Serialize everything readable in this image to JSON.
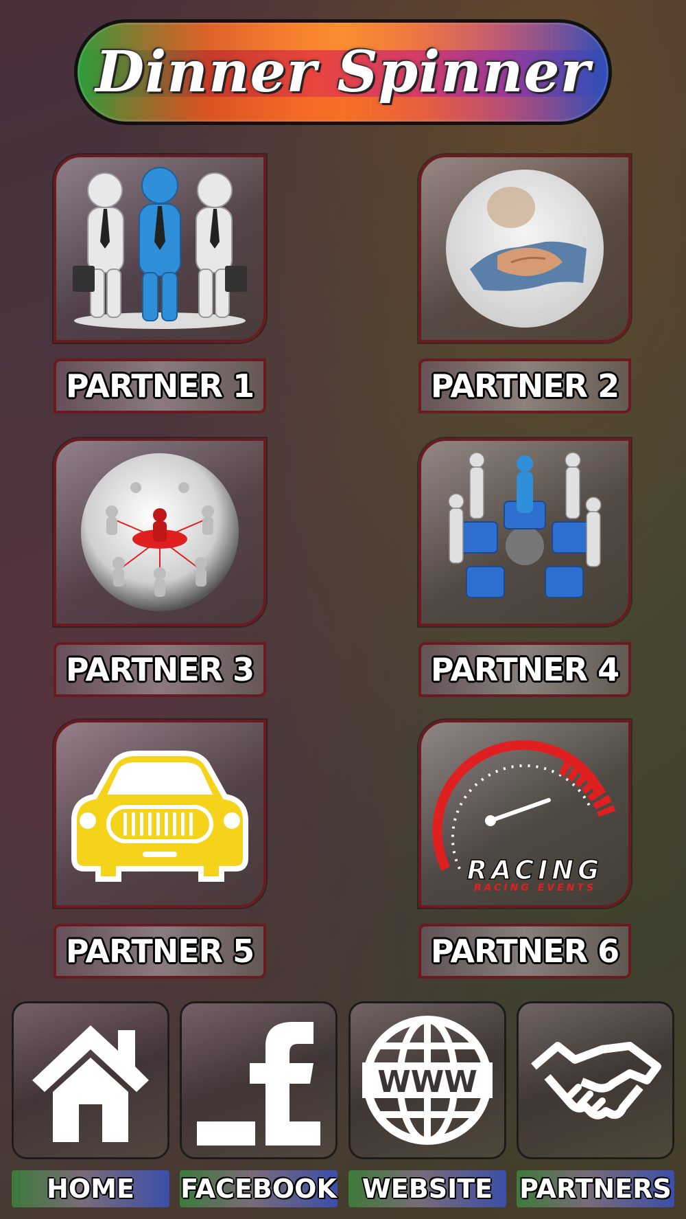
{
  "header": {
    "title": "Dinner Spinner"
  },
  "partners": [
    {
      "label": "PARTNER 1",
      "icon": "business-team-icon"
    },
    {
      "label": "PARTNER 2",
      "icon": "handshake-photo-icon"
    },
    {
      "label": "PARTNER 3",
      "icon": "network-people-icon"
    },
    {
      "label": "PARTNER 4",
      "icon": "puzzle-team-icon"
    },
    {
      "label": "PARTNER 5",
      "icon": "yellow-car-icon"
    },
    {
      "label": "PARTNER 6",
      "icon": "racing-speedometer-icon"
    }
  ],
  "racing_logo": {
    "title": "RACING",
    "subtitle": "RACING EVENTS"
  },
  "nav": [
    {
      "label": "HOME",
      "icon": "home-icon"
    },
    {
      "label": "FACEBOOK",
      "icon": "facebook-icon"
    },
    {
      "label": "WEBSITE",
      "icon": "globe-www-icon"
    },
    {
      "label": "PARTNERS",
      "icon": "handshake-icon"
    }
  ],
  "globe_text": "WWW",
  "colors": {
    "tile_border": "#6b1b1f",
    "accent_red": "#e02020",
    "car_yellow": "#f5d31a",
    "person_blue": "#2f8fd8"
  }
}
